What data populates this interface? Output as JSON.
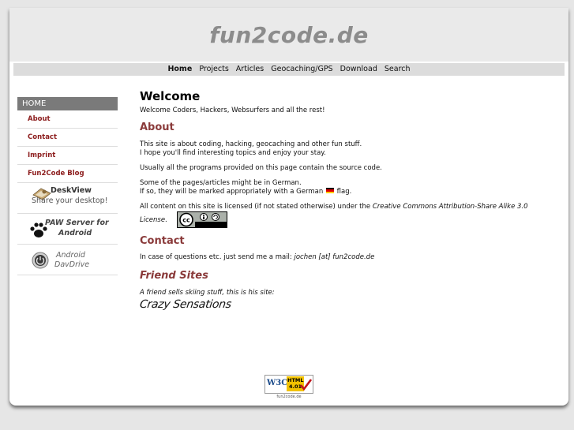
{
  "site": {
    "title": "fun2code.de"
  },
  "nav": [
    {
      "label": "Home",
      "active": true
    },
    {
      "label": "Projects",
      "active": false
    },
    {
      "label": "Articles",
      "active": false
    },
    {
      "label": "Geocaching/GPS",
      "active": false
    },
    {
      "label": "Download",
      "active": false
    },
    {
      "label": "Search",
      "active": false
    }
  ],
  "sidebar": {
    "heading": "HOME",
    "items": [
      "About",
      "Contact",
      "Imprint",
      "Fun2Code Blog"
    ],
    "banners": {
      "deskview": {
        "title": "DeskView",
        "subtitle": "Share your desktop!"
      },
      "paw": {
        "line1": "PAW Server for",
        "line2": "Android"
      },
      "davdrive": {
        "line1": "Android",
        "line2": "DavDrive"
      }
    }
  },
  "content": {
    "welcome_heading": "Welcome",
    "welcome_text": "Welcome Coders, Hackers, Websurfers and all the rest!",
    "about_heading": "About",
    "about_line1": "This site is about coding, hacking, geocaching and other fun stuff.",
    "about_line2": "I hope you'll find interesting topics and enjoy your stay.",
    "about_p2": "Usually all the programs provided on this page contain the source code.",
    "about_p3_line1": "Some of the pages/articles might be in German.",
    "about_p3_line2a": "If so, they will be marked appropriately with a German",
    "about_p3_line2b": "flag.",
    "license_pre": "All content on this site is licensed (if not stated otherwise) under the",
    "license_name": "Creative Commons Attribution-Share Alike 3.0",
    "license_word": "License",
    "contact_heading": "Contact",
    "contact_text": "In case of questions etc. just send me a mail:",
    "contact_email": "jochen [at] fun2code.de",
    "friends_heading": "Friend Sites",
    "friends_text": "A friend sells skiing stuff, this is his site:",
    "friends_logo": "Crazy Sensations"
  },
  "footer": {
    "w3c": "W3C",
    "html_label": "HTML",
    "html_version": "4.01",
    "domain": "fun2code.de"
  },
  "colors": {
    "heading_accent": "#8a3a3a",
    "sidebar_link": "#8c1c1c",
    "sidebar_header": "#7a7a7a",
    "title_gray": "#8c8c8c"
  }
}
